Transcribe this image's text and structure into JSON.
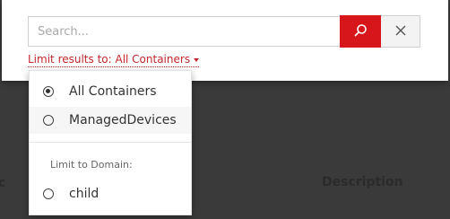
{
  "background": {
    "left_label": "c",
    "description_header": "Description"
  },
  "search": {
    "placeholder": "Search...",
    "search_icon": "search-icon",
    "clear_icon": "close-icon",
    "accent_color": "#d7161b"
  },
  "limit": {
    "label": "Limit results to: All Containers"
  },
  "dropdown": {
    "options": [
      {
        "label": "All Containers",
        "checked": true
      },
      {
        "label": "ManagedDevices",
        "checked": false
      }
    ],
    "domain_section_label": "Limit to Domain:",
    "domain_options": [
      {
        "label": "child",
        "checked": false
      }
    ]
  }
}
